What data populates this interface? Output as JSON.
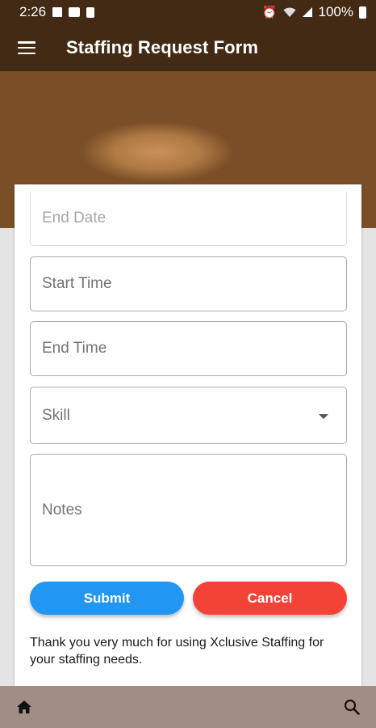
{
  "status_bar": {
    "time": "2:26",
    "battery": "100%"
  },
  "app_bar": {
    "title": "Staffing Request Form",
    "menu_icon": "hamburger-menu-icon"
  },
  "form": {
    "end_date_placeholder": "End Date",
    "start_time_placeholder": "Start Time",
    "end_time_placeholder": "End Time",
    "skill_placeholder": "Skill",
    "notes_placeholder": "Notes"
  },
  "buttons": {
    "submit_label": "Submit",
    "cancel_label": "Cancel"
  },
  "footer_message": "Thank you very much for using Xclusive Staffing for your staffing needs.",
  "bottom_nav": {
    "home_icon": "home-icon",
    "search_icon": "search-icon"
  },
  "colors": {
    "submit": "#2196f3",
    "cancel": "#f44336",
    "bottom_bar": "#a28d84"
  }
}
